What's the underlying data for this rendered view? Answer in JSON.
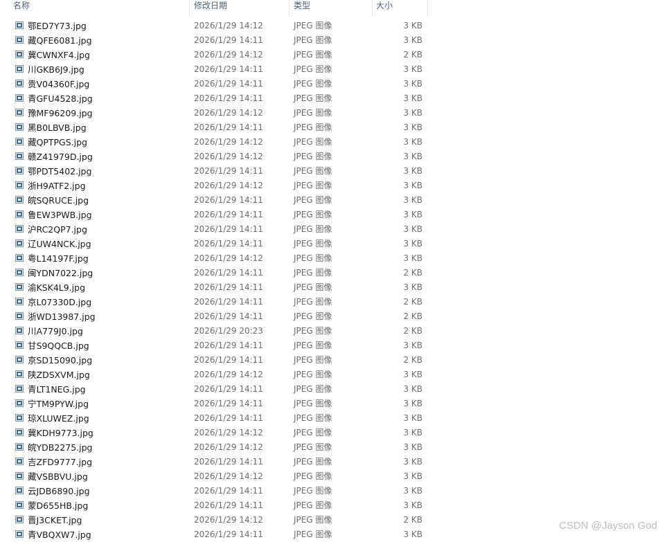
{
  "header": {
    "name": "名称",
    "date": "修改日期",
    "type": "类型",
    "size": "大小"
  },
  "files": [
    {
      "name": "鄂ED7Y73.jpg",
      "date": "2026/1/29 14:12",
      "type": "JPEG 图像",
      "size": "3 KB"
    },
    {
      "name": "藏QFE6081.jpg",
      "date": "2026/1/29 14:11",
      "type": "JPEG 图像",
      "size": "3 KB"
    },
    {
      "name": "冀CWNXF4.jpg",
      "date": "2026/1/29 14:12",
      "type": "JPEG 图像",
      "size": "2 KB"
    },
    {
      "name": "川GKB6J9.jpg",
      "date": "2026/1/29 14:11",
      "type": "JPEG 图像",
      "size": "3 KB"
    },
    {
      "name": "贵V04360F.jpg",
      "date": "2026/1/29 14:11",
      "type": "JPEG 图像",
      "size": "3 KB"
    },
    {
      "name": "青GFU4528.jpg",
      "date": "2026/1/29 14:11",
      "type": "JPEG 图像",
      "size": "3 KB"
    },
    {
      "name": "豫MF96209.jpg",
      "date": "2026/1/29 14:12",
      "type": "JPEG 图像",
      "size": "3 KB"
    },
    {
      "name": "黑B0LBVB.jpg",
      "date": "2026/1/29 14:11",
      "type": "JPEG 图像",
      "size": "3 KB"
    },
    {
      "name": "藏QPTPGS.jpg",
      "date": "2026/1/29 14:12",
      "type": "JPEG 图像",
      "size": "3 KB"
    },
    {
      "name": "赣Z41979D.jpg",
      "date": "2026/1/29 14:12",
      "type": "JPEG 图像",
      "size": "3 KB"
    },
    {
      "name": "鄂PDT5402.jpg",
      "date": "2026/1/29 14:11",
      "type": "JPEG 图像",
      "size": "3 KB"
    },
    {
      "name": "浙H9ATF2.jpg",
      "date": "2026/1/29 14:12",
      "type": "JPEG 图像",
      "size": "3 KB"
    },
    {
      "name": "皖SQRUCE.jpg",
      "date": "2026/1/29 14:11",
      "type": "JPEG 图像",
      "size": "3 KB"
    },
    {
      "name": "鲁EW3PWB.jpg",
      "date": "2026/1/29 14:11",
      "type": "JPEG 图像",
      "size": "3 KB"
    },
    {
      "name": "沪RC2QP7.jpg",
      "date": "2026/1/29 14:11",
      "type": "JPEG 图像",
      "size": "3 KB"
    },
    {
      "name": "辽UW4NCK.jpg",
      "date": "2026/1/29 14:11",
      "type": "JPEG 图像",
      "size": "3 KB"
    },
    {
      "name": "粤L14197F.jpg",
      "date": "2026/1/29 14:12",
      "type": "JPEG 图像",
      "size": "3 KB"
    },
    {
      "name": "闽YDN7022.jpg",
      "date": "2026/1/29 14:11",
      "type": "JPEG 图像",
      "size": "2 KB"
    },
    {
      "name": "渝KSK4L9.jpg",
      "date": "2026/1/29 14:11",
      "type": "JPEG 图像",
      "size": "3 KB"
    },
    {
      "name": "京L07330D.jpg",
      "date": "2026/1/29 14:11",
      "type": "JPEG 图像",
      "size": "2 KB"
    },
    {
      "name": "浙WD13987.jpg",
      "date": "2026/1/29 14:11",
      "type": "JPEG 图像",
      "size": "2 KB"
    },
    {
      "name": "川A779J0.jpg",
      "date": "2026/1/29 20:23",
      "type": "JPEG 图像",
      "size": "2 KB"
    },
    {
      "name": "甘S9QQCB.jpg",
      "date": "2026/1/29 14:11",
      "type": "JPEG 图像",
      "size": "3 KB"
    },
    {
      "name": "京SD15090.jpg",
      "date": "2026/1/29 14:11",
      "type": "JPEG 图像",
      "size": "2 KB"
    },
    {
      "name": "陕ZDSXVM.jpg",
      "date": "2026/1/29 14:12",
      "type": "JPEG 图像",
      "size": "3 KB"
    },
    {
      "name": "青LT1NEG.jpg",
      "date": "2026/1/29 14:11",
      "type": "JPEG 图像",
      "size": "3 KB"
    },
    {
      "name": "宁TM9PYW.jpg",
      "date": "2026/1/29 14:11",
      "type": "JPEG 图像",
      "size": "3 KB"
    },
    {
      "name": "琼XLUWEZ.jpg",
      "date": "2026/1/29 14:11",
      "type": "JPEG 图像",
      "size": "3 KB"
    },
    {
      "name": "冀KDH9773.jpg",
      "date": "2026/1/29 14:12",
      "type": "JPEG 图像",
      "size": "3 KB"
    },
    {
      "name": "皖YDB2275.jpg",
      "date": "2026/1/29 14:12",
      "type": "JPEG 图像",
      "size": "3 KB"
    },
    {
      "name": "吉ZFD9777.jpg",
      "date": "2026/1/29 14:11",
      "type": "JPEG 图像",
      "size": "3 KB"
    },
    {
      "name": "藏VSBBVU.jpg",
      "date": "2026/1/29 14:12",
      "type": "JPEG 图像",
      "size": "3 KB"
    },
    {
      "name": "云JDB6890.jpg",
      "date": "2026/1/29 14:11",
      "type": "JPEG 图像",
      "size": "3 KB"
    },
    {
      "name": "蒙D655HB.jpg",
      "date": "2026/1/29 14:11",
      "type": "JPEG 图像",
      "size": "3 KB"
    },
    {
      "name": "晋J3CKET.jpg",
      "date": "2026/1/29 14:12",
      "type": "JPEG 图像",
      "size": "2 KB"
    },
    {
      "name": "青VBQXW7.jpg",
      "date": "2026/1/29 14:11",
      "type": "JPEG 图像",
      "size": "3 KB"
    }
  ],
  "watermark": "CSDN @Jayson God",
  "icons": {
    "file_icon": "jpeg-file-icon"
  },
  "colors": {
    "header_text": "#4c607a",
    "icon_blue": "#2f6fb8",
    "watermark": "#bdbdbd"
  }
}
